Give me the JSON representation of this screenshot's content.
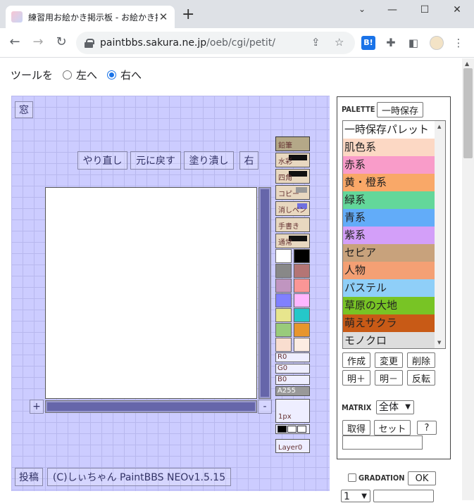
{
  "browser": {
    "tab_title": "練習用お絵かき掲示板 - お絵かき掲",
    "url_host": "paintbbs.sakura.ne.jp",
    "url_path": "/oeb/cgi/petit/",
    "ext_label": "B!"
  },
  "tool_position": {
    "label": "ツールを",
    "left": "左へ",
    "right": "右へ",
    "selected": "右へ"
  },
  "paint": {
    "window_button": "窓",
    "redo": "やり直し",
    "undo": "元に戻す",
    "fill": "塗り潰し",
    "side": "右",
    "zoom_in": "+",
    "zoom_out": "-",
    "post": "投稿",
    "credit": "(C)しぃちゃん PaintBBS NEOv1.5.15",
    "tools": [
      "鉛筆",
      "水彩",
      "四角",
      "コピー",
      "消しペン",
      "手書き",
      "通常"
    ],
    "swatches": [
      "#ffffff",
      "#000000",
      "#888888",
      "#b47575",
      "#c095c0",
      "#fa9696",
      "#8080ff",
      "#ffb6ff",
      "#e7e58d",
      "#25c7c9",
      "#99cb7b",
      "#e7962d",
      "#f9ddcf",
      "#fcece2"
    ],
    "sliders": {
      "r": "R0",
      "g": "G0",
      "b": "B0",
      "a": "A255"
    },
    "brush_size": "1px",
    "layer": "Layer0"
  },
  "palette": {
    "title": "PALETTE",
    "temp_save": "一時保存",
    "items": [
      {
        "label": "一時保存パレット",
        "color": "#ffffff"
      },
      {
        "label": "肌色系",
        "color": "#fcd8c4"
      },
      {
        "label": "赤系",
        "color": "#f99cc9"
      },
      {
        "label": "黄・橙系",
        "color": "#f9a868"
      },
      {
        "label": "緑系",
        "color": "#63d79a"
      },
      {
        "label": "青系",
        "color": "#62acf9"
      },
      {
        "label": "紫系",
        "color": "#d39ff9"
      },
      {
        "label": "セピア",
        "color": "#c8a27c"
      },
      {
        "label": "人物",
        "color": "#f4a074"
      },
      {
        "label": "パステル",
        "color": "#8fcff8"
      },
      {
        "label": "草原の大地",
        "color": "#78c425"
      },
      {
        "label": "萌えサクラ",
        "color": "#c85a16"
      },
      {
        "label": "モノクロ",
        "color": "#dddddd"
      }
    ],
    "create": "作成",
    "change": "変更",
    "delete": "削除",
    "brighter": "明＋",
    "darker": "明－",
    "invert": "反転",
    "matrix_label": "MATRIX",
    "matrix_value": "全体",
    "get": "取得",
    "set": "セット",
    "help": "?",
    "gradation_label": "GRADATION",
    "ok": "OK",
    "grad_value": "1"
  }
}
